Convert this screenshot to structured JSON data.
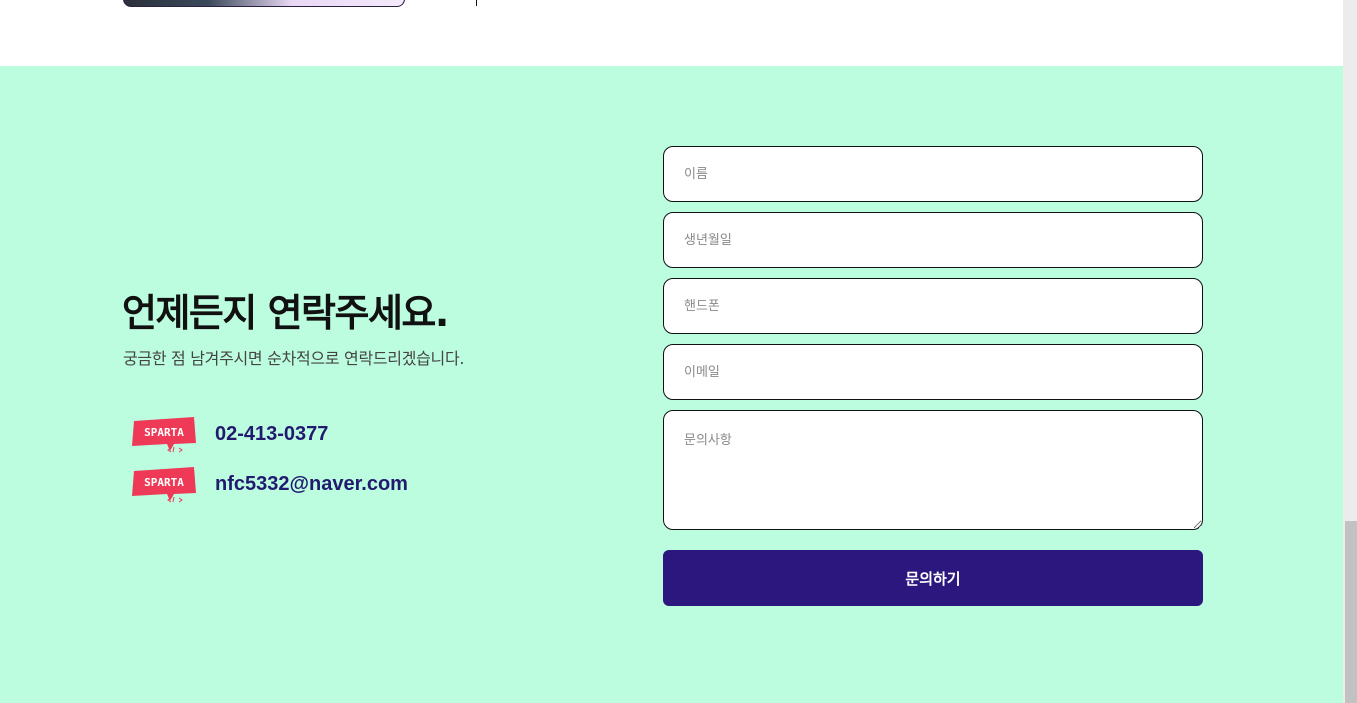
{
  "contact": {
    "heading": "언제든지 연락주세요.",
    "subtext": "궁금한 점 남겨주시면 순차적으로 연락드리겠습니다.",
    "logo_text": "SPARTA",
    "phone": "02-413-0377",
    "email": "nfc5332@naver.com"
  },
  "form": {
    "name_placeholder": "이름",
    "birth_placeholder": "생년월일",
    "phone_placeholder": "핸드폰",
    "email_placeholder": "이메일",
    "inquiry_placeholder": "문의사항",
    "submit_label": "문의하기"
  },
  "colors": {
    "section_bg": "#bcfde0",
    "button_bg": "#2c177f",
    "contact_text": "#221a6e",
    "logo_red": "#ee3a57"
  }
}
